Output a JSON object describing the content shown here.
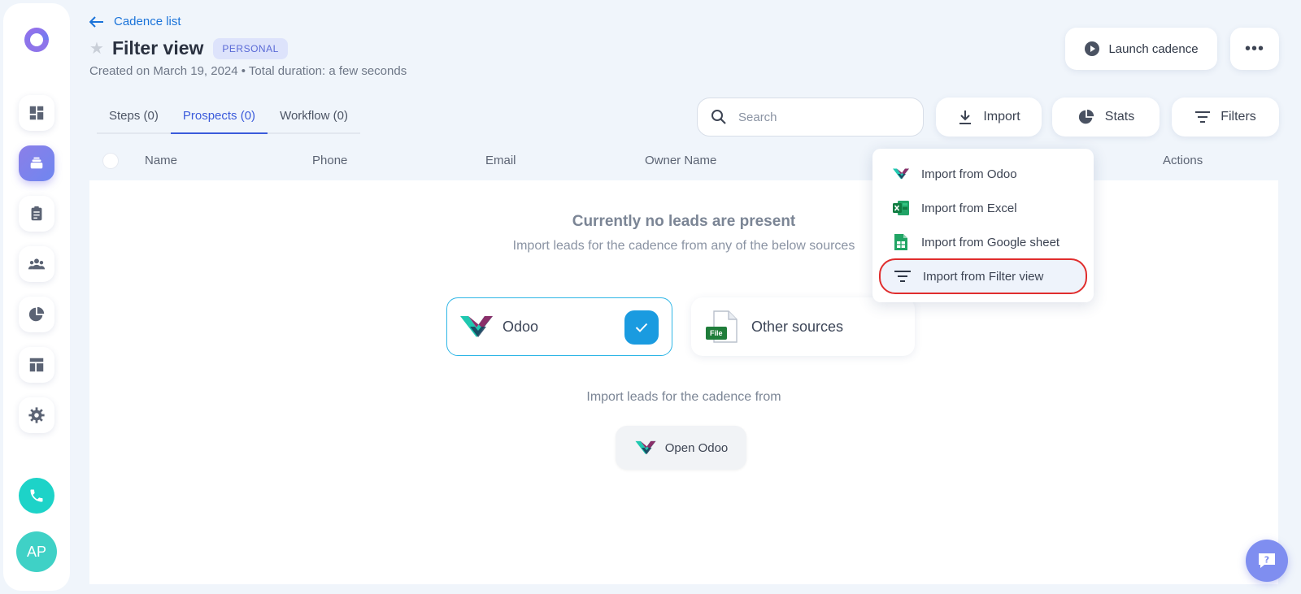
{
  "header": {
    "back_label": "Cadence list",
    "title": "Filter view",
    "badge": "PERSONAL",
    "subtitle": "Created on March 19, 2024 • Total duration: a few seconds",
    "launch_label": "Launch cadence"
  },
  "tabs": [
    {
      "label": "Steps (0)",
      "active": false
    },
    {
      "label": "Prospects (0)",
      "active": true
    },
    {
      "label": "Workflow (0)",
      "active": false
    }
  ],
  "toolbar": {
    "search_placeholder": "Search",
    "import_label": "Import",
    "stats_label": "Stats",
    "filters_label": "Filters"
  },
  "table": {
    "columns": [
      "Name",
      "Phone",
      "Email",
      "Owner Name",
      "Actions"
    ]
  },
  "empty_state": {
    "title": "Currently no leads are present",
    "subtitle": "Import leads for the cadence from any of the below sources",
    "sources": [
      {
        "label": "Odoo",
        "selected": true
      },
      {
        "label": "Other sources",
        "selected": false
      }
    ],
    "file_badge": "File",
    "from_label": "Import leads for the cadence from",
    "open_label": "Open Odoo"
  },
  "import_menu": {
    "items": [
      {
        "label": "Import from Odoo",
        "icon": "odoo-icon"
      },
      {
        "label": "Import from Excel",
        "icon": "excel-icon"
      },
      {
        "label": "Import from Google sheet",
        "icon": "google-sheet-icon"
      },
      {
        "label": "Import from Filter view",
        "icon": "filter-icon",
        "highlighted": true
      }
    ]
  },
  "user": {
    "initials": "AP"
  },
  "colors": {
    "accent": "#3b5bdb",
    "link": "#1a73d9",
    "odoo_selected_border": "#2fb6e6",
    "check_blue": "#1a9be0",
    "highlight_ring": "#e02d2d",
    "phone_teal": "#1dd3c8"
  }
}
